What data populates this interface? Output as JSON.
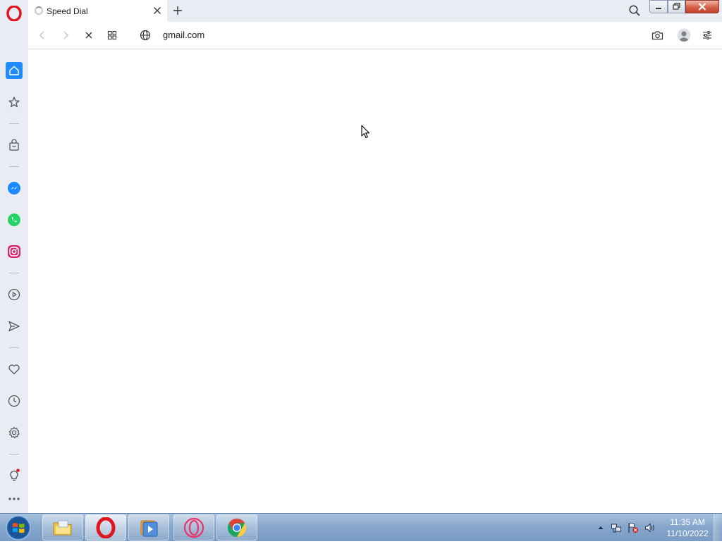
{
  "browser": {
    "tab": {
      "title": "Speed Dial"
    },
    "address": {
      "url": "gmail.com"
    }
  },
  "sidebar": {
    "items": [
      {
        "name": "home",
        "icon": "home-icon"
      },
      {
        "name": "speed-dial",
        "icon": "star-icon"
      },
      {
        "name": "shopping",
        "icon": "shopping-bag-icon"
      },
      {
        "name": "messenger",
        "icon": "messenger-icon",
        "color": "#1a8cff"
      },
      {
        "name": "whatsapp",
        "icon": "whatsapp-icon",
        "color": "#25d366"
      },
      {
        "name": "instagram",
        "icon": "instagram-icon",
        "color": "#e1306c"
      },
      {
        "name": "player",
        "icon": "play-icon"
      },
      {
        "name": "flow",
        "icon": "send-icon"
      },
      {
        "name": "pinboards",
        "icon": "heart-icon"
      },
      {
        "name": "history",
        "icon": "clock-icon"
      },
      {
        "name": "settings",
        "icon": "gear-icon"
      },
      {
        "name": "tips",
        "icon": "lightbulb-icon"
      },
      {
        "name": "more",
        "icon": "more-icon"
      }
    ]
  },
  "taskbar": {
    "time": "11:35 AM",
    "date": "11/10/2022"
  },
  "colors": {
    "accent": "#1f8bff",
    "opera_red": "#e0151f",
    "chrome_green": "#1fa463"
  }
}
